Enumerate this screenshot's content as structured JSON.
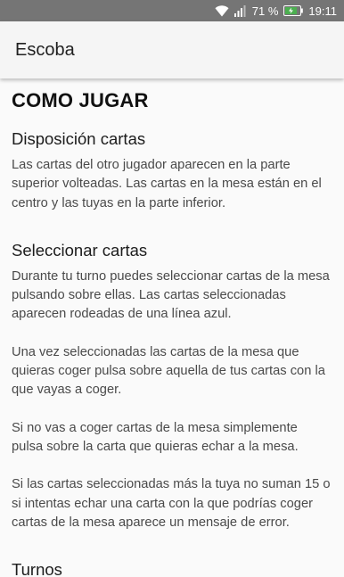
{
  "status_bar": {
    "wifi_icon": "wifi-icon",
    "signal_icon": "signal-icon",
    "battery_percent": "71 %",
    "battery_icon": "battery-charging-icon",
    "time": "19:11"
  },
  "toolbar": {
    "title": "Escoba"
  },
  "page": {
    "heading": "COMO JUGAR",
    "sections": [
      {
        "title": "Disposición cartas",
        "paragraphs": [
          "Las cartas del otro jugador aparecen en la parte superior volteadas. Las cartas en la mesa están en el centro y las tuyas en la parte inferior."
        ]
      },
      {
        "title": "Seleccionar cartas",
        "paragraphs": [
          "Durante tu turno puedes seleccionar cartas de la mesa pulsando sobre ellas. Las cartas seleccionadas aparecen rodeadas de una línea azul.",
          "Una vez seleccionadas las cartas de la mesa que quieras coger pulsa sobre aquella de tus cartas con la que vayas a coger.",
          "Si no vas a coger cartas de la mesa simplemente pulsa sobre la carta que quieras echar a la mesa.",
          "Si las cartas seleccionadas más la tuya no suman 15 o si intentas echar una carta con la que podrías coger cartas de la mesa aparece un mensaje de error."
        ]
      },
      {
        "title": "Turnos",
        "paragraphs": []
      }
    ]
  },
  "colors": {
    "status_bar_bg": "#757575",
    "toolbar_bg": "#f5f5f5",
    "page_bg": "#fafafa",
    "body_text": "#4a4a4a",
    "battery_green": "#4caf50"
  }
}
